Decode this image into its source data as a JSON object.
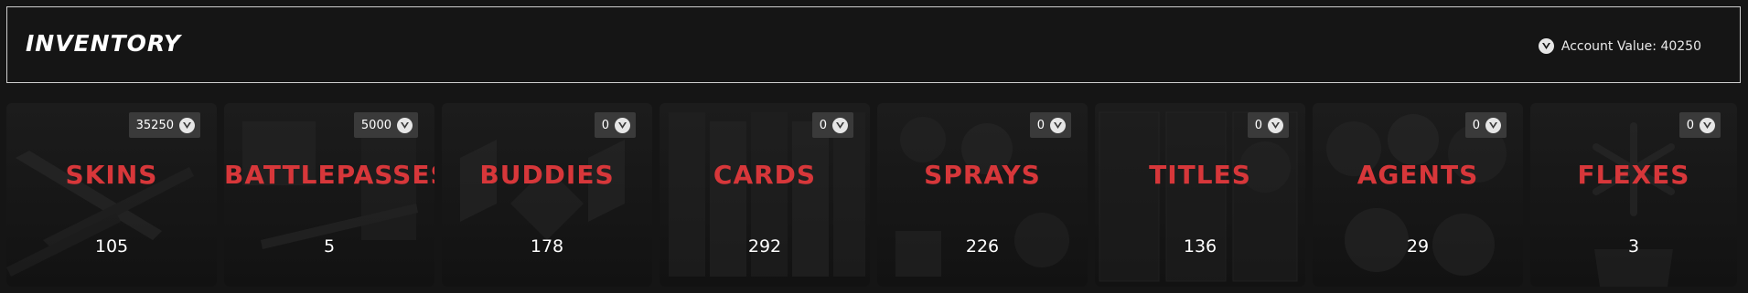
{
  "header": {
    "title": "INVENTORY",
    "account_value_label": "Account Value: 40250",
    "currency_icon": "valorant-points-icon"
  },
  "tiles": [
    {
      "label": "SKINS",
      "count": "105",
      "value": "35250"
    },
    {
      "label": "BATTLEPASSES",
      "count": "5",
      "value": "5000"
    },
    {
      "label": "BUDDIES",
      "count": "178",
      "value": "0"
    },
    {
      "label": "CARDS",
      "count": "292",
      "value": "0"
    },
    {
      "label": "SPRAYS",
      "count": "226",
      "value": "0"
    },
    {
      "label": "TITLES",
      "count": "136",
      "value": "0"
    },
    {
      "label": "AGENTS",
      "count": "29",
      "value": "0"
    },
    {
      "label": "FLEXES",
      "count": "3",
      "value": "0"
    }
  ],
  "colors": {
    "background": "#151515",
    "tile_label": "#d7373a",
    "badge_bg": "#3a3a3a",
    "border": "#cfcfcf"
  }
}
